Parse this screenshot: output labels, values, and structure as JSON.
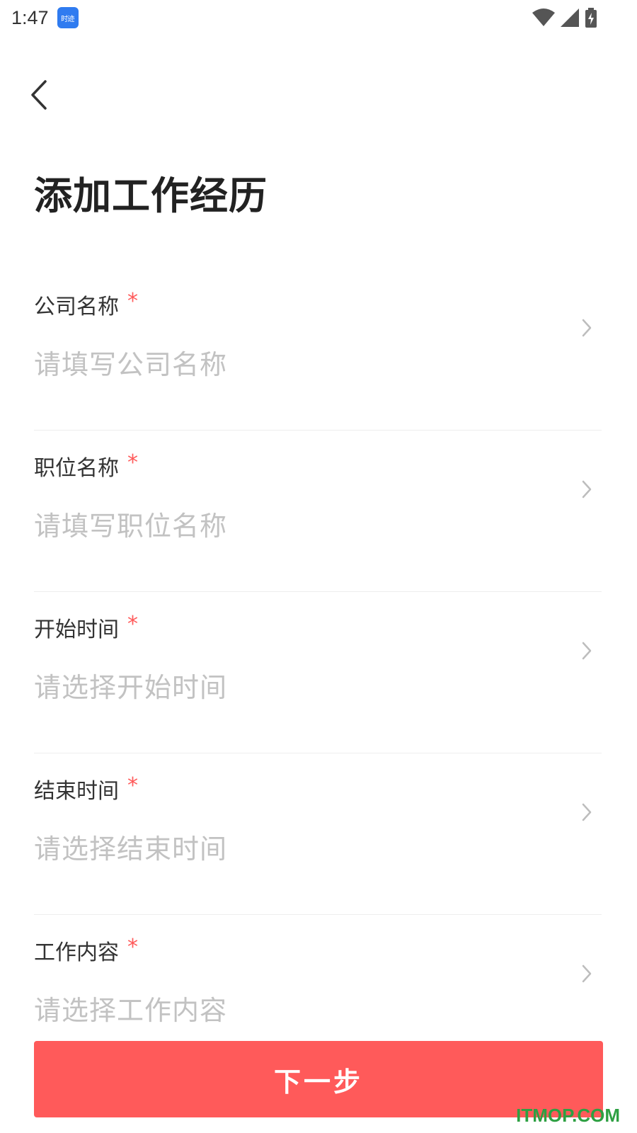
{
  "status_bar": {
    "time": "1:47",
    "app_badge": "时迹",
    "icons": [
      "wifi-icon",
      "signal-icon",
      "battery-charging-icon"
    ]
  },
  "header": {
    "back_icon": "chevron-left-icon",
    "title": "添加工作经历"
  },
  "form": {
    "fields": [
      {
        "label": "公司名称",
        "required_mark": "*",
        "placeholder": "请填写公司名称"
      },
      {
        "label": "职位名称",
        "required_mark": "*",
        "placeholder": "请填写职位名称"
      },
      {
        "label": "开始时间",
        "required_mark": "*",
        "placeholder": "请选择开始时间"
      },
      {
        "label": "结束时间",
        "required_mark": "*",
        "placeholder": "请选择结束时间"
      },
      {
        "label": "工作内容",
        "required_mark": "*",
        "placeholder": "请选择工作内容"
      }
    ]
  },
  "footer": {
    "next_label": "下一步",
    "watermark": "ITMOP.COM"
  },
  "colors": {
    "accent": "#ff5a5a",
    "placeholder": "#c2c2c2",
    "divider": "#eeeeee",
    "watermark": "#2ea043"
  }
}
